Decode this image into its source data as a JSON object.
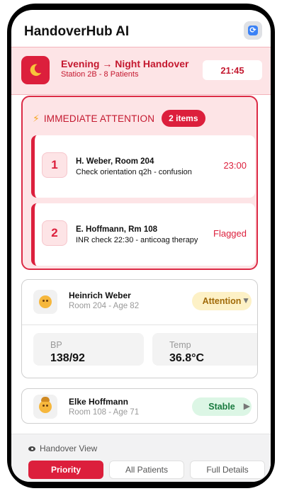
{
  "app": {
    "title": "HandoverHub AI"
  },
  "shift": {
    "title": "Evening → Night Handover",
    "subtitle": "Station 2B - 8 Patients",
    "time": "21:45"
  },
  "attention": {
    "title": "IMMEDIATE ATTENTION",
    "count_label": "2 items",
    "items": [
      {
        "number": "1",
        "patient": "H. Weber, Room 204",
        "task": "Check orientation q2h - confusion",
        "meta": "23:00"
      },
      {
        "number": "2",
        "patient": "E. Hoffmann, Rm 108",
        "task": "INR check 22:30 - anticoag therapy",
        "meta": "Flagged"
      }
    ]
  },
  "patients": [
    {
      "name": "Heinrich Weber",
      "details": "Room 204 - Age 82",
      "status": "Attention",
      "vitals": [
        {
          "label": "BP",
          "value": "138/92"
        },
        {
          "label": "Temp",
          "value": "36.8°C"
        }
      ]
    },
    {
      "name": "Elke Hoffmann",
      "details": "Room 108 - Age 71",
      "status": "Stable"
    }
  ],
  "footer": {
    "view_label": "Handover View",
    "tabs": [
      "Priority",
      "All Patients",
      "Full Details"
    ]
  },
  "colors": {
    "accent": "#dc1f3c",
    "attention_bg": "#fde4e6",
    "warning": "#f5a623",
    "stable": "#187a3e"
  },
  "icons": [
    "refresh-icon",
    "moon-icon",
    "lightning-icon",
    "patient-avatar-icon",
    "chevron-down-icon",
    "chevron-right-icon",
    "eye-icon"
  ]
}
